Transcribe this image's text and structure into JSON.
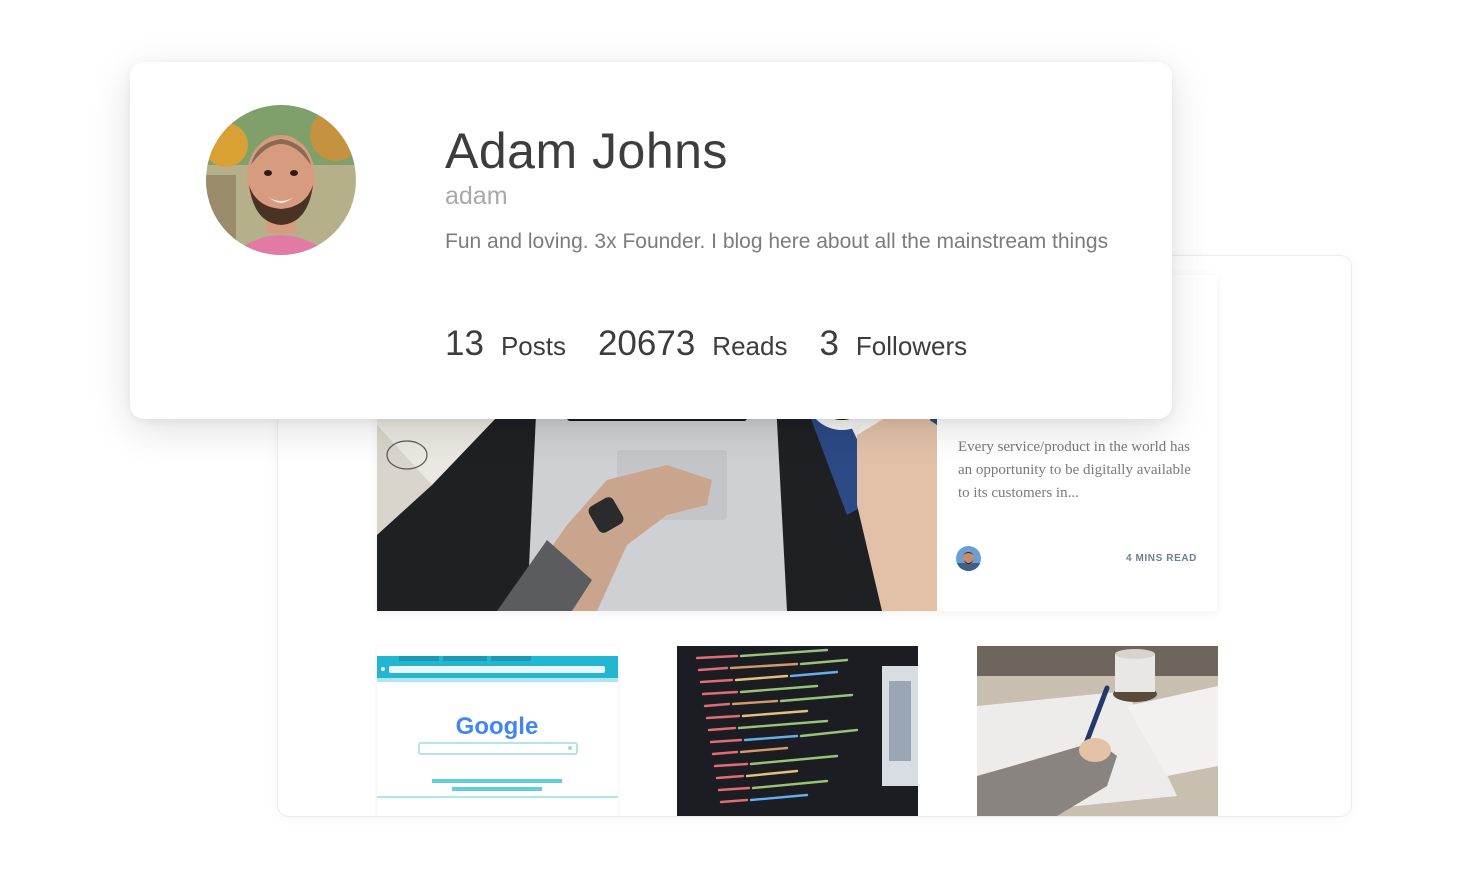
{
  "profile": {
    "name": "Adam Johns",
    "username": "adam",
    "bio": "Fun and loving. 3x Founder. I blog here about all the mainstream things",
    "stats": [
      {
        "count": "13",
        "label": "Posts"
      },
      {
        "count": "20673",
        "label": "Reads"
      },
      {
        "count": "3",
        "label": "Followers"
      }
    ]
  },
  "featured_post": {
    "excerpt": "Every service/product in the world has an opportunity to be digitally available to its customers in...",
    "read_time": "4 MINS READ"
  },
  "thumbnail_google": {
    "logo_text": "Google"
  },
  "colors": {
    "google_blue": "#4285f4",
    "google_red": "#ea4335",
    "google_yellow": "#fbbc05",
    "google_green": "#34a853",
    "thumb_accent": "#22b6d0"
  }
}
